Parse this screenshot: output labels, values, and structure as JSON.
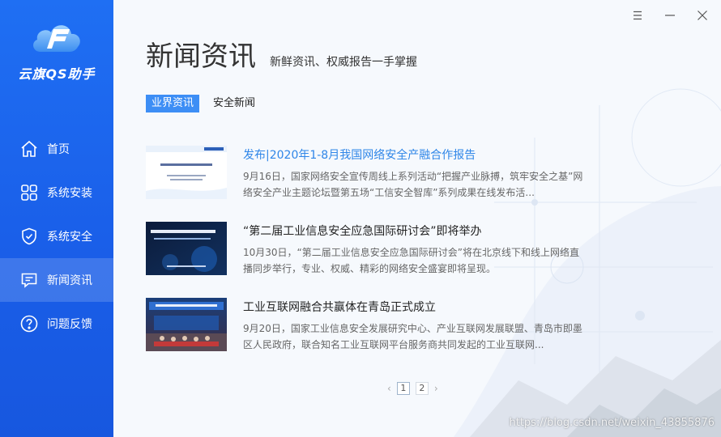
{
  "app": {
    "logo_text": "云旗QS助手"
  },
  "sidebar": {
    "items": [
      {
        "label": "首页",
        "icon": "home-icon",
        "active": false
      },
      {
        "label": "系统安装",
        "icon": "grid-icon",
        "active": false
      },
      {
        "label": "系统安全",
        "icon": "shield-check-icon",
        "active": false
      },
      {
        "label": "新闻资讯",
        "icon": "message-icon",
        "active": true
      },
      {
        "label": "问题反馈",
        "icon": "help-circle-icon",
        "active": false
      }
    ]
  },
  "window": {
    "controls": [
      "menu-icon",
      "minimize-icon",
      "close-icon"
    ]
  },
  "header": {
    "title": "新闻资讯",
    "subtitle": "新鲜资讯、权威报告一手掌握"
  },
  "tabs": [
    {
      "label": "业界资讯",
      "active": true
    },
    {
      "label": "安全新闻",
      "active": false
    }
  ],
  "news": [
    {
      "title": "发布|2020年1-8月我国网络安全产融合作报告",
      "desc": "9月16日，国家网络安全宣传周线上系列活动“把握产业脉搏，筑牢安全之基”网络安全产业主题论坛暨第五场“工信安全智库”系列成果在线发布活...",
      "highlight": true
    },
    {
      "title": "“第二届工业信息安全应急国际研讨会”即将举办",
      "desc": "10月30日，“第二届工业信息安全应急国际研讨会”将在北京线下和线上网络直播同步举行，专业、权威、精彩的网络安全盛宴即将呈现。",
      "highlight": false
    },
    {
      "title": "工业互联网融合共赢体在青岛正式成立",
      "desc": " 9月20日，国家工业信息安全发展研究中心、产业互联网发展联盟、青岛市即墨区人民政府，联合知名工业互联网平台服务商共同发起的工业互联网...",
      "highlight": false
    }
  ],
  "pagination": {
    "prev": "‹",
    "pages": [
      "1",
      "2"
    ],
    "current": "1",
    "next": "›"
  },
  "watermark": "https://blog.csdn.net/weixin_43855876",
  "colors": {
    "sidebar": "#1a63ec",
    "accent": "#3d8ef5",
    "link": "#2f86e8"
  }
}
